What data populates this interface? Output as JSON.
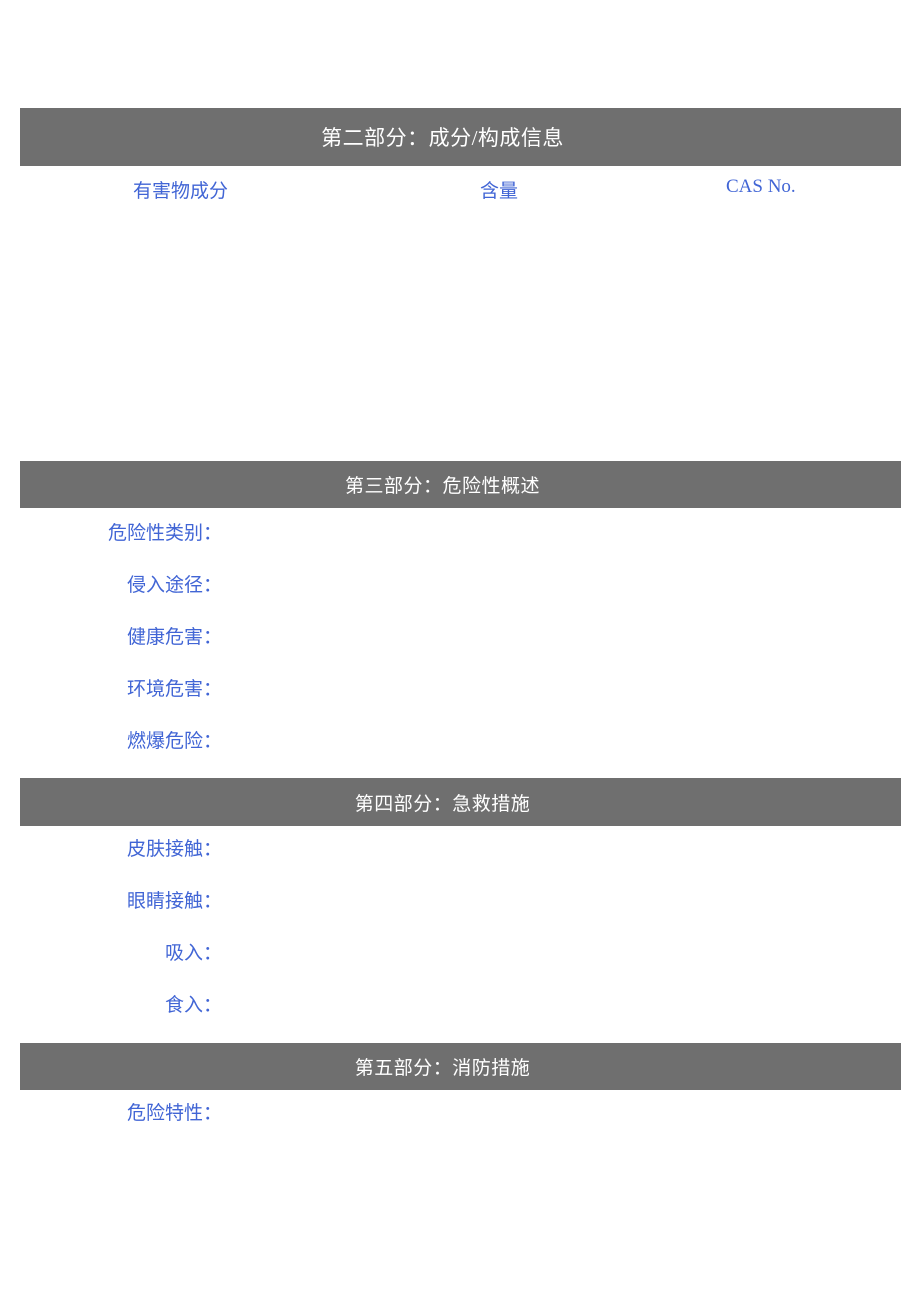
{
  "document": {
    "type": "msds-safety-data-sheet",
    "page_background": "#ffffff",
    "bar_color": "#6f6f6f",
    "bar_text_color": "#ffffff",
    "field_text_color": "#4165d5"
  },
  "sections": {
    "section2": {
      "title": "第二部分：成分/构成信息",
      "table": {
        "headers": {
          "component": "有害物成分",
          "content": "含量",
          "cas": "CAS No."
        },
        "rows": [
          {
            "component": "",
            "content": "",
            "cas": ""
          },
          {
            "component": "",
            "content": "",
            "cas": ""
          },
          {
            "component": "",
            "content": "",
            "cas": ""
          },
          {
            "component": "",
            "content": "",
            "cas": ""
          },
          {
            "component": "",
            "content": "",
            "cas": ""
          },
          {
            "component": "",
            "content": "",
            "cas": ""
          }
        ]
      }
    },
    "section3": {
      "title": "第三部分：危险性概述",
      "fields": [
        {
          "label": "危险性类别：",
          "value": ""
        },
        {
          "label": "侵入途径：",
          "value": ""
        },
        {
          "label": "健康危害：",
          "value": ""
        },
        {
          "label": "环境危害：",
          "value": ""
        },
        {
          "label": "燃爆危险：",
          "value": ""
        }
      ]
    },
    "section4": {
      "title": "第四部分：急救措施",
      "fields": [
        {
          "label": "皮肤接触：",
          "value": ""
        },
        {
          "label": "眼睛接触：",
          "value": ""
        },
        {
          "label": "吸入：",
          "value": ""
        },
        {
          "label": "食入：",
          "value": ""
        }
      ]
    },
    "section5": {
      "title": "第五部分：消防措施",
      "fields": [
        {
          "label": "危险特性：",
          "value": ""
        }
      ]
    }
  }
}
